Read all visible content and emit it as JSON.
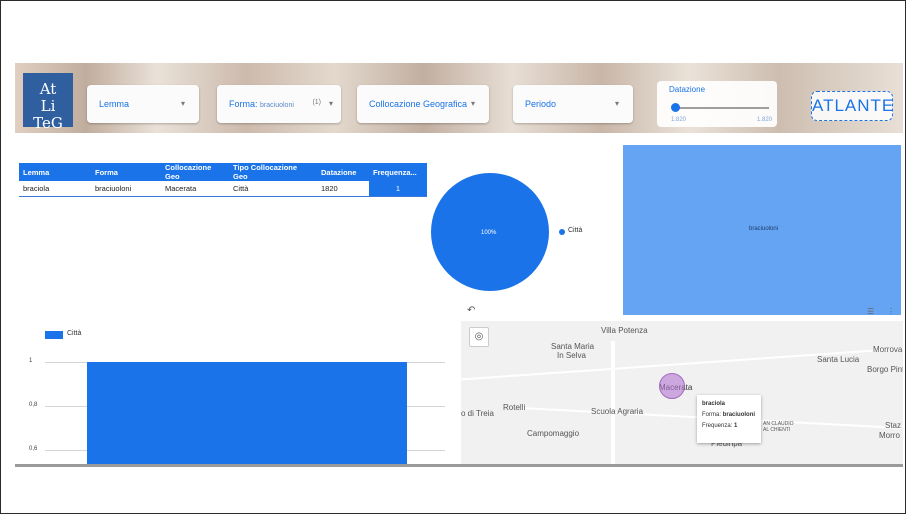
{
  "header": {
    "logo_text": "AtLiTeG",
    "filters": {
      "lemma": "Lemma",
      "forma_label": "Forma:",
      "forma_value": "braciuoloni",
      "forma_count": "(1)",
      "collocazione": "Collocazione Geografica",
      "periodo": "Periodo"
    },
    "datazione": {
      "title": "Datazione",
      "min": "1.820",
      "max": "1.820"
    },
    "atlante": "ATLANTE"
  },
  "table": {
    "columns": [
      "Lemma",
      "Forma",
      "Collocazione Geo",
      "Tipo Collocazione Geo",
      "Datazione",
      "Frequenza..."
    ],
    "rows": [
      [
        "braciola",
        "braciuoloni",
        "Macerata",
        "Città",
        "1820",
        "1"
      ]
    ]
  },
  "pie": {
    "slice_label": "100%",
    "legend": "Città",
    "color": "#1a73e8"
  },
  "treemap": {
    "label": "braciuoloni",
    "color": "#64a4f2"
  },
  "chart_data": {
    "type": "bar",
    "categories": [
      ""
    ],
    "series": [
      {
        "name": "Città",
        "values": [
          1
        ]
      }
    ],
    "yticks": [
      "1",
      "0,8",
      "0,6"
    ],
    "ylim": [
      0.55,
      1.05
    ],
    "legend": "top-left"
  },
  "map": {
    "places": [
      "Villa Potenza",
      "Santa Maria",
      "In Selva",
      "Santa Lucia",
      "Morrova",
      "Borgo Pint",
      "Macerata",
      "Rotelli",
      "Scuola Agraria",
      "o di Treia",
      "Campomaggio",
      "AN CLAUDIO",
      "AL CHIENTI",
      "Staz",
      "Morro",
      "Piediripa"
    ],
    "tooltip": {
      "lemma": "braciola",
      "forma_label": "Forma:",
      "forma_value": "braciuoloni",
      "freq_label": "Frequenza:",
      "freq_value": "1"
    }
  }
}
